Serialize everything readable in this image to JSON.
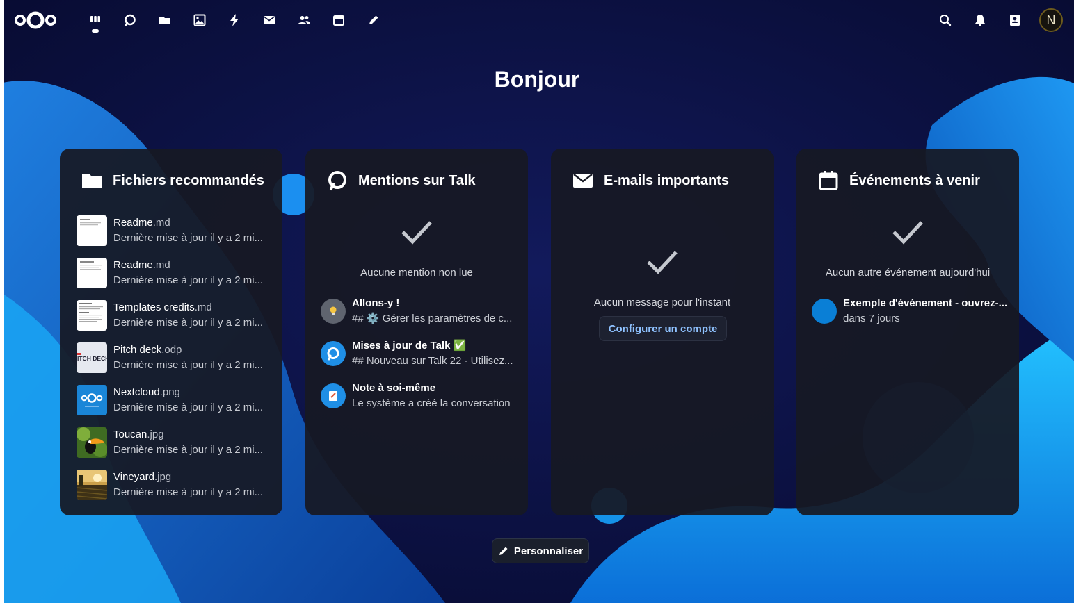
{
  "header": {
    "apps": [
      {
        "name": "dashboard-app",
        "icon": "dashboard-icon",
        "active": true
      },
      {
        "name": "talk-app",
        "icon": "talk-icon"
      },
      {
        "name": "files-app",
        "icon": "folder-icon"
      },
      {
        "name": "photos-app",
        "icon": "image-icon"
      },
      {
        "name": "activity-app",
        "icon": "lightning-icon"
      },
      {
        "name": "mail-app",
        "icon": "mail-icon"
      },
      {
        "name": "contacts-app",
        "icon": "contacts-icon"
      },
      {
        "name": "calendar-app",
        "icon": "calendar-icon"
      },
      {
        "name": "notes-app",
        "icon": "pencil-icon"
      }
    ],
    "avatar_initial": "N"
  },
  "greeting": "Bonjour",
  "widgets": {
    "files": {
      "title": "Fichiers recommandés",
      "items": [
        {
          "base": "Readme",
          "ext": ".md",
          "subtitle": "Dernière mise à jour il y a 2 mi...",
          "thumb": "document"
        },
        {
          "base": "Readme",
          "ext": ".md",
          "subtitle": "Dernière mise à jour il y a 2 mi...",
          "thumb": "document"
        },
        {
          "base": "Templates credits",
          "ext": ".md",
          "subtitle": "Dernière mise à jour il y a 2 mi...",
          "thumb": "document"
        },
        {
          "base": "Pitch deck",
          "ext": ".odp",
          "subtitle": "Dernière mise à jour il y a 2 mi...",
          "thumb": "slides",
          "thumb_text": "ITCH DECK"
        },
        {
          "base": "Nextcloud",
          "ext": ".png",
          "subtitle": "Dernière mise à jour il y a 2 mi...",
          "thumb": "logo"
        },
        {
          "base": "Toucan",
          "ext": ".jpg",
          "subtitle": "Dernière mise à jour il y a 2 mi...",
          "thumb": "photo-toucan"
        },
        {
          "base": "Vineyard",
          "ext": ".jpg",
          "subtitle": "Dernière mise à jour il y a 2 mi...",
          "thumb": "photo-vineyard"
        }
      ]
    },
    "talk": {
      "title": "Mentions sur Talk",
      "empty": "Aucune mention non lue",
      "items": [
        {
          "title": "Allons-y !",
          "subtitle": "## ⚙️ Gérer les paramètres de c...",
          "icon": "lightbulb-icon"
        },
        {
          "title": "Mises à jour de Talk ✅",
          "subtitle": "## Nouveau sur Talk 22 - Utilisez...",
          "icon": "talk-icon"
        },
        {
          "title": "Note à soi-même",
          "subtitle": "Le système a créé la conversation",
          "icon": "note-icon"
        }
      ]
    },
    "mail": {
      "title": "E-mails importants",
      "empty": "Aucun message pour l'instant",
      "button": "Configurer un compte"
    },
    "events": {
      "title": "Événements à venir",
      "empty": "Aucun autre événement aujourd'hui",
      "items": [
        {
          "title": "Exemple d'événement - ouvrez-...",
          "subtitle": "dans 7 jours",
          "color": "#0a7fd6"
        }
      ]
    }
  },
  "customize_button": "Personnaliser",
  "colors": {
    "accent": "#1e9fff",
    "background": "#0b0f3a",
    "panel": "#171924",
    "link": "#8fc2ff"
  }
}
